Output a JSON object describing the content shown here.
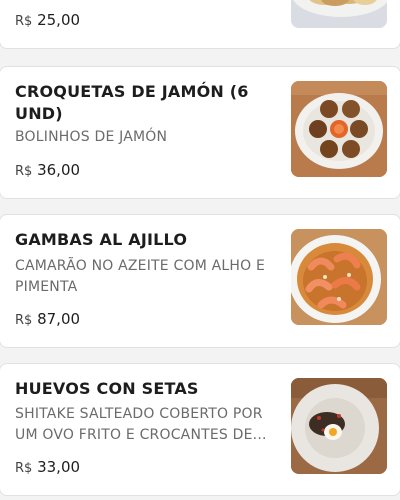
{
  "items": [
    {
      "price_currency": "R$",
      "price_value": "25,00",
      "image_icon": "bread-plate-photo"
    },
    {
      "title": "CROQUETAS DE JAMÓN (6 UND)",
      "description": "BOLINHOS DE JAMÓN",
      "price_currency": "R$",
      "price_value": "36,00",
      "image_icon": "croquetas-photo"
    },
    {
      "title": "GAMBAS AL AJILLO",
      "description": "CAMARÃO NO AZEITE COM ALHO E PIMENTA",
      "price_currency": "R$",
      "price_value": "87,00",
      "image_icon": "shrimp-photo"
    },
    {
      "title": "HUEVOS CON SETAS",
      "description": "SHITAKE SALTEADO COBERTO POR UM OVO FRITO E CROCANTES DE...",
      "price_currency": "R$",
      "price_value": "33,00",
      "image_icon": "egg-mushroom-photo"
    }
  ]
}
